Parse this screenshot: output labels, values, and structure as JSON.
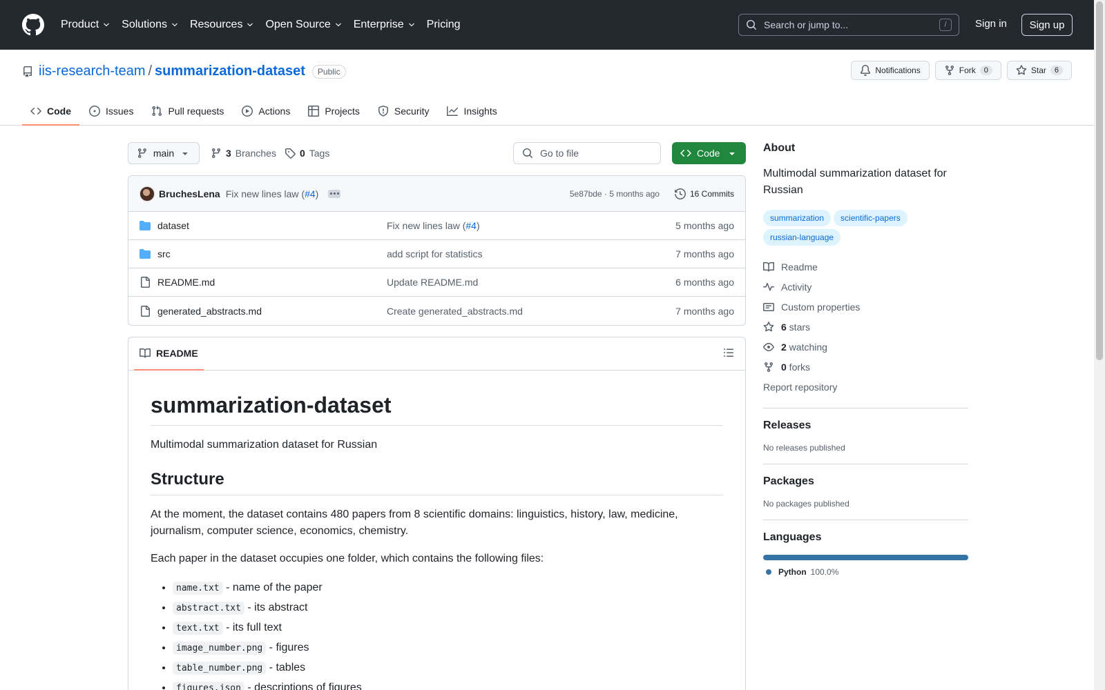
{
  "header": {
    "nav": [
      {
        "label": "Product",
        "chevron": true
      },
      {
        "label": "Solutions",
        "chevron": true
      },
      {
        "label": "Resources",
        "chevron": true
      },
      {
        "label": "Open Source",
        "chevron": true
      },
      {
        "label": "Enterprise",
        "chevron": true
      },
      {
        "label": "Pricing",
        "chevron": false
      }
    ],
    "search_placeholder": "Search or jump to...",
    "search_shortcut": "/",
    "sign_in": "Sign in",
    "sign_up": "Sign up"
  },
  "repo": {
    "owner": "iis-research-team",
    "separator": "/",
    "name": "summarization-dataset",
    "visibility": "Public",
    "notifications_label": "Notifications",
    "fork_label": "Fork",
    "fork_count": "0",
    "star_label": "Star",
    "star_count": "6"
  },
  "tabs": [
    "Code",
    "Issues",
    "Pull requests",
    "Actions",
    "Projects",
    "Security",
    "Insights"
  ],
  "toolbar": {
    "branch": "main",
    "branches_count": "3",
    "branches_label": "Branches",
    "tags_count": "0",
    "tags_label": "Tags",
    "goto_placeholder": "Go to file",
    "code_label": "Code"
  },
  "commit": {
    "author": "BruchesLena",
    "message": "Fix new lines law (",
    "pr": "#4",
    "message_end": ")",
    "hash_time": "5e87bde · 5 months ago",
    "commits_label": "16 Commits"
  },
  "files": [
    {
      "type": "folder",
      "name": "dataset",
      "msg": "Fix new lines law (",
      "pr": "#4",
      "msg_end": ")",
      "date": "5 months ago"
    },
    {
      "type": "folder",
      "name": "src",
      "msg": "add script for statistics",
      "pr": "",
      "msg_end": "",
      "date": "7 months ago"
    },
    {
      "type": "file",
      "name": "README.md",
      "msg": "Update README.md",
      "pr": "",
      "msg_end": "",
      "date": "6 months ago"
    },
    {
      "type": "file",
      "name": "generated_abstracts.md",
      "msg": "Create generated_abstracts.md",
      "pr": "",
      "msg_end": "",
      "date": "7 months ago"
    }
  ],
  "readme": {
    "tab_label": "README",
    "h1": "summarization-dataset",
    "intro": "Multimodal summarization dataset for Russian",
    "h2": "Structure",
    "p1": "At the moment, the dataset contains 480 papers from 8 scientific domains: linguistics, history, law, medicine, journalism, computer science, economics, chemistry.",
    "p2": "Each paper in the dataset occupies one folder, which contains the following files:",
    "items": [
      {
        "code": "name.txt",
        "desc": " - name of the paper"
      },
      {
        "code": "abstract.txt",
        "desc": " - its abstract"
      },
      {
        "code": "text.txt",
        "desc": " - its full text"
      },
      {
        "code": "image_number.png",
        "desc": " - figures"
      },
      {
        "code": "table_number.png",
        "desc": " - tables"
      },
      {
        "code": "figures.json",
        "desc": " - descriptions of figures"
      }
    ]
  },
  "about": {
    "heading": "About",
    "description": "Multimodal summarization dataset for Russian",
    "topics": [
      "summarization",
      "scientific-papers",
      "russian-language"
    ],
    "links": [
      {
        "icon": "book-icon",
        "bold": "",
        "label": "Readme"
      },
      {
        "icon": "pulse-icon",
        "bold": "",
        "label": "Activity"
      },
      {
        "icon": "note-icon",
        "bold": "",
        "label": "Custom properties"
      },
      {
        "icon": "star-icon",
        "bold": "6",
        "label": " stars"
      },
      {
        "icon": "eye-icon",
        "bold": "2",
        "label": " watching"
      },
      {
        "icon": "fork-icon",
        "bold": "0",
        "label": " forks"
      }
    ],
    "report": "Report repository"
  },
  "releases": {
    "heading": "Releases",
    "text": "No releases published"
  },
  "packages": {
    "heading": "Packages",
    "text": "No packages published"
  },
  "languages": {
    "heading": "Languages",
    "items": [
      {
        "name": "Python",
        "percent": "100.0%",
        "color": "#3572a5",
        "share": 1.0
      }
    ]
  }
}
